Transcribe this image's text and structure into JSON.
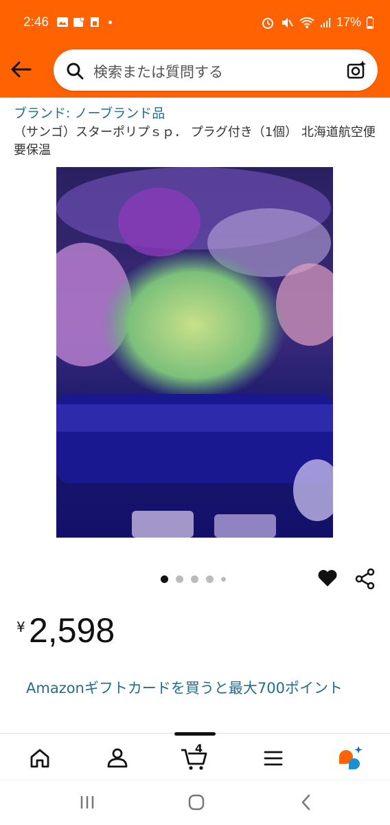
{
  "status_bar": {
    "time": "2:46",
    "battery": "17%"
  },
  "search": {
    "placeholder": "検索または質問する"
  },
  "product": {
    "brand": "ブランド: ノーブランド品",
    "title": "（サンゴ）スターポリプｓｐ． プラグ付き（1個） 北海道航空便要保温",
    "price_currency": "¥",
    "price_value": "2,598",
    "promo": "Amazonギフトカードを買うと最大700ポイント"
  },
  "carousel": {
    "count": 5,
    "active_index": 0
  },
  "bottom_nav": {
    "cart_count": "4"
  },
  "colors": {
    "header": "#ff6200",
    "link": "#1f6f8b"
  }
}
